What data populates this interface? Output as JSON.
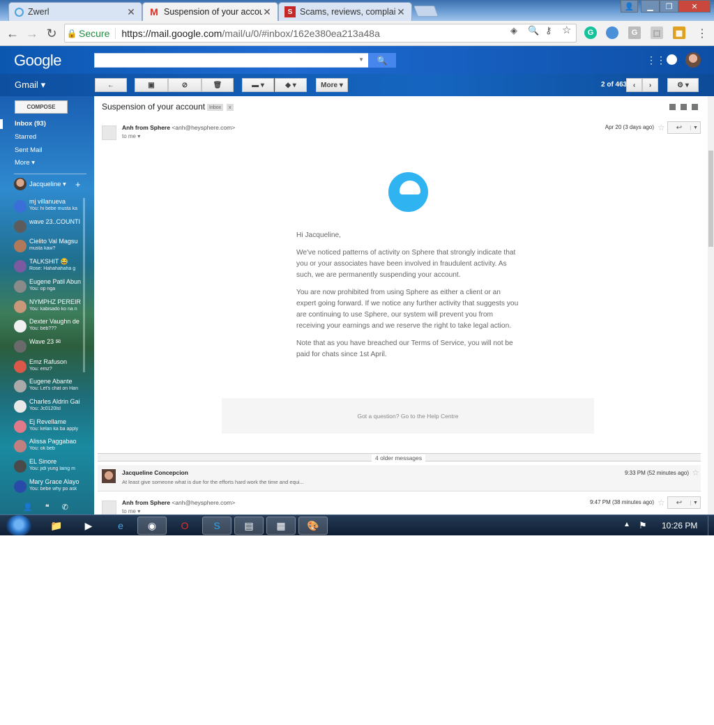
{
  "browser": {
    "tabs": [
      {
        "title": "Zwerl",
        "icon": "zwerl-icon",
        "active": false
      },
      {
        "title": "Suspension of your accou",
        "icon": "gmail-icon",
        "active": true
      },
      {
        "title": "Scams, reviews, complain",
        "icon": "sitejabber-icon",
        "active": false
      }
    ],
    "secure_label": "Secure",
    "url_host": "https://mail.google.com",
    "url_rest": "/mail/u/0/#inbox/162e380ea213a48a"
  },
  "gmail": {
    "logo": "Google",
    "app_label": "Gmail",
    "compose": "COMPOSE",
    "nav": [
      {
        "label": "Inbox (93)",
        "bold": true
      },
      {
        "label": "Starred",
        "bold": false
      },
      {
        "label": "Sent Mail",
        "bold": false
      },
      {
        "label": "More",
        "bold": false
      }
    ],
    "me": "Jacqueline",
    "contacts": [
      {
        "name": "mj villanueva",
        "msg": "You: hi bebe musta ka",
        "color": "#3a6fd8"
      },
      {
        "name": "wave 23..COUNTI",
        "msg": "",
        "color": "#5c5c5c"
      },
      {
        "name": "Cielito Val Magsu",
        "msg": "musta kaw?",
        "color": "#b07a5a"
      },
      {
        "name": "TALKSHIT 😂",
        "msg": "Rose: Hahahahaha g",
        "color": "#7a5aa0"
      },
      {
        "name": "Eugene Patil Abun",
        "msg": "You: op nga",
        "color": "#8a8a8a"
      },
      {
        "name": "NYMPHZ PEREIR",
        "msg": "You: kabisado ko na n",
        "color": "#c9987a"
      },
      {
        "name": "Dexter Vaughn de",
        "msg": "You: beb???",
        "color": "#f0f0f0"
      },
      {
        "name": "Wave 23 ✉",
        "msg": "",
        "color": "#6a6a6a"
      },
      {
        "name": "Emz Rafuson",
        "msg": "You: emz?",
        "color": "#d9584a"
      },
      {
        "name": "Eugene Abante",
        "msg": "You: Let's chat on Han",
        "color": "#aaaaaa"
      },
      {
        "name": "Charles Aldrin Gai",
        "msg": "You: Jc0120lsl",
        "color": "#e8e8e8"
      },
      {
        "name": "Ej Revellame",
        "msg": "You: kelan ka ba apply",
        "color": "#e07a8a"
      },
      {
        "name": "Alissa Paggabao",
        "msg": "You: ok beb",
        "color": "#c08080"
      },
      {
        "name": "EL Sinore",
        "msg": "You: jidi yung laing m",
        "color": "#4a4a4a"
      },
      {
        "name": "Mary Grace Alayo",
        "msg": "You: bebe why po ask",
        "color": "#2a4aa8"
      }
    ],
    "pager": "2 of 463",
    "more_label": "More"
  },
  "thread": {
    "subject": "Suspension of your account",
    "label_chip": "Inbox",
    "label_x": "x",
    "message1": {
      "from_name": "Anh from Sphere",
      "from_email": "<anh@heysphere.com>",
      "to": "to me",
      "date": "Apr 20 (3 days ago)"
    },
    "greeting": "Hi Jacqueline,",
    "para1": "We've noticed patterns of activity on Sphere that strongly indicate that you or your associates have been involved in fraudulent activity. As such, we are permanently suspending your account.",
    "para2": "You are now prohibited from using Sphere as either a client or an expert going forward. If we notice any further activity that suggests you are continuing to use Sphere, our system will prevent you from receiving your earnings and we reserve the right to take legal action.",
    "para3": "Note that as you have breached our Terms of Service, you will not be paid for chats since 1st April.",
    "help": "Got a question? Go to the Help Centre",
    "older": "4 older messages",
    "collapsed": {
      "from_name": "Jacqueline Concepcion",
      "snippet": "At least give someone what is due for the efforts hard work the time and equi...",
      "date": "9:33 PM (52 minutes ago)"
    },
    "message3": {
      "from_name": "Anh from Sphere",
      "from_email": "<anh@heysphere.com>",
      "to": "to me",
      "date": "9:47 PM (38 minutes ago)"
    }
  },
  "taskbar": {
    "clock": "10:26 PM"
  }
}
